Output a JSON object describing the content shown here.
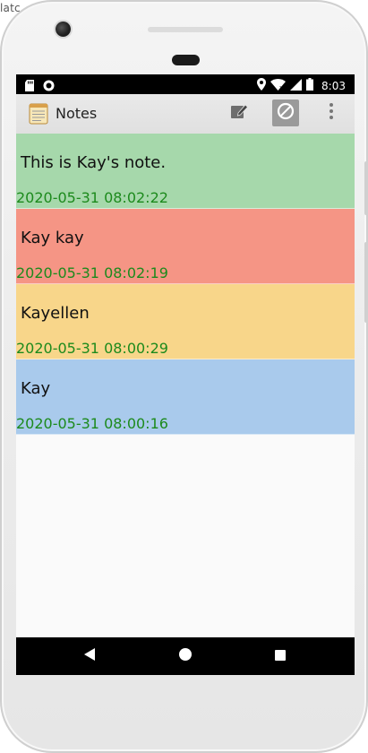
{
  "corner": {
    "text": "latc"
  },
  "status_bar": {
    "time": "8:03",
    "icons": [
      "sd-card-icon",
      "notification-dot-icon",
      "location-icon",
      "wifi-icon",
      "signal-icon",
      "battery-icon"
    ]
  },
  "action_bar": {
    "title": "Notes",
    "icons": [
      "notes-app-icon",
      "new-note-icon",
      "search-icon",
      "overflow-menu-icon"
    ]
  },
  "notes": [
    {
      "title": "This is Kay's note.",
      "date": "2020-05-31 08:02:22",
      "color": "#a6d8ab"
    },
    {
      "title": "Kay kay",
      "date": "2020-05-31 08:02:19",
      "color": "#f59585"
    },
    {
      "title": "Kayellen",
      "date": "2020-05-31 08:00:29",
      "color": "#f8d68a"
    },
    {
      "title": "Kay",
      "date": "2020-05-31 08:00:16",
      "color": "#a9caec"
    }
  ],
  "colors": {
    "date_text": "#1c8a1c",
    "status_bar_bg": "#000000",
    "nav_bar_bg": "#000000",
    "action_bar_bg": "#e5e5e5"
  },
  "nav_bar": {
    "icons": [
      "back-icon",
      "home-icon",
      "recents-icon"
    ]
  }
}
